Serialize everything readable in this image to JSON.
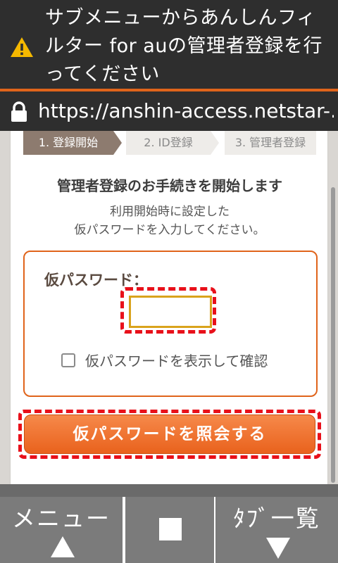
{
  "notice": {
    "icon": "warning-icon",
    "text": "サブメニューからあんしんフィルター for auの管理者登録を行ってください"
  },
  "urlbar": {
    "icon": "lock-icon",
    "url": "https://anshin-access.netstar-..."
  },
  "steps": [
    {
      "label": "1. 登録開始"
    },
    {
      "label": "2. ID登録"
    },
    {
      "label": "3. 管理者登録"
    }
  ],
  "main": {
    "heading": "管理者登録のお手続きを開始します",
    "description": "利用開始時に設定した\n仮パスワードを入力してください。",
    "password_label": "仮パスワード：",
    "password_value": "",
    "show_password_label": "仮パスワードを表示して確認",
    "submit_label": "仮パスワードを照会する"
  },
  "nav": {
    "menu_label": "メニュー",
    "tabs_label": "ﾀﾌﾞ一覧"
  },
  "colors": {
    "accent": "#e0641b",
    "highlight": "#e8101a",
    "step_active": "#8d7b6f"
  }
}
